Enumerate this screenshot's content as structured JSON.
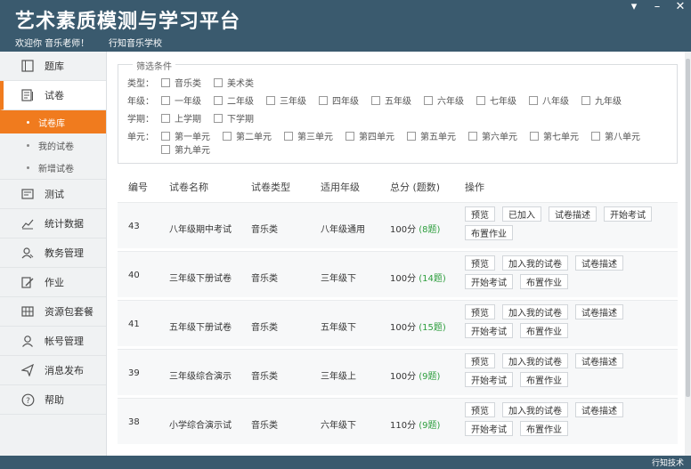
{
  "header": {
    "title": "艺术素质模测与学习平台",
    "welcome": "欢迎你 音乐老师！",
    "school": "行知音乐学校"
  },
  "window": {
    "menu_symbol": "▾",
    "minimize_symbol": "–",
    "close_symbol": "✕"
  },
  "sidebar": {
    "items": [
      {
        "label": "题库",
        "icon": "bank-icon"
      },
      {
        "label": "试卷",
        "icon": "paper-icon"
      },
      {
        "label": "测试",
        "icon": "test-icon"
      },
      {
        "label": "统计数据",
        "icon": "chart-icon"
      },
      {
        "label": "教务管理",
        "icon": "admin-icon"
      },
      {
        "label": "作业",
        "icon": "homework-icon"
      },
      {
        "label": "资源包套餐",
        "icon": "package-icon"
      },
      {
        "label": "帐号管理",
        "icon": "account-icon"
      },
      {
        "label": "消息发布",
        "icon": "message-icon"
      },
      {
        "label": "帮助",
        "icon": "help-icon"
      }
    ],
    "sub_items": [
      {
        "label": "试卷库"
      },
      {
        "label": "我的试卷"
      },
      {
        "label": "新增试卷"
      }
    ]
  },
  "filter": {
    "legend": "筛选条件",
    "type_label": "类型：",
    "types": [
      "音乐类",
      "美术类"
    ],
    "grade_label": "年级：",
    "grades": [
      "一年级",
      "二年级",
      "三年级",
      "四年级",
      "五年级",
      "六年级",
      "七年级",
      "八年级",
      "九年级"
    ],
    "term_label": "学期：",
    "terms": [
      "上学期",
      "下学期"
    ],
    "unit_label": "单元：",
    "units": [
      "第一单元",
      "第二单元",
      "第三单元",
      "第四单元",
      "第五单元",
      "第六单元",
      "第七单元",
      "第八单元",
      "第九单元"
    ]
  },
  "table": {
    "headers": {
      "id": "编号",
      "name": "试卷名称",
      "type": "试卷类型",
      "grade": "适用年级",
      "score": "总分 (题数)",
      "ops": "操作"
    },
    "rows": [
      {
        "id": "43",
        "name": "八年级期中考试",
        "type": "音乐类",
        "grade": "八年级通用",
        "score": "100分",
        "count": "(8题)",
        "ops": [
          "预览",
          "已加入",
          "试卷描述",
          "开始考试",
          "布置作业"
        ]
      },
      {
        "id": "40",
        "name": "三年级下册试卷",
        "type": "音乐类",
        "grade": "三年级下",
        "score": "100分",
        "count": "(14题)",
        "ops": [
          "预览",
          "加入我的试卷",
          "试卷描述",
          "开始考试",
          "布置作业"
        ]
      },
      {
        "id": "41",
        "name": "五年级下册试卷",
        "type": "音乐类",
        "grade": "五年级下",
        "score": "100分",
        "count": "(15题)",
        "ops": [
          "预览",
          "加入我的试卷",
          "试卷描述",
          "开始考试",
          "布置作业"
        ]
      },
      {
        "id": "39",
        "name": "三年级综合演示",
        "type": "音乐类",
        "grade": "三年级上",
        "score": "100分",
        "count": "(9题)",
        "ops": [
          "预览",
          "加入我的试卷",
          "试卷描述",
          "开始考试",
          "布置作业"
        ]
      },
      {
        "id": "38",
        "name": "小学综合演示试",
        "type": "音乐类",
        "grade": "六年级下",
        "score": "110分",
        "count": "(9题)",
        "ops": [
          "预览",
          "加入我的试卷",
          "试卷描述",
          "开始考试",
          "布置作业"
        ]
      }
    ]
  },
  "watermark": "行知技术",
  "colors": {
    "header": "#3a5a6e",
    "accent": "#f07b1e",
    "count": "#2e9e3e"
  }
}
